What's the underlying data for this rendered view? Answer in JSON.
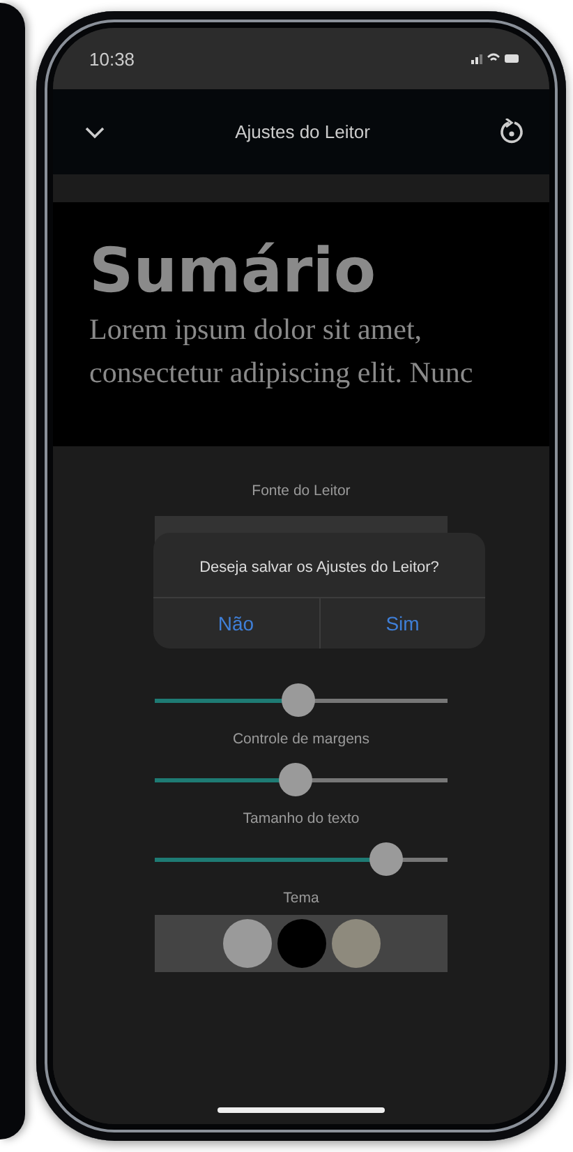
{
  "status_bar": {
    "time": "10:38"
  },
  "nav_bar": {
    "title": "Ajustes do Leitor"
  },
  "preview": {
    "heading": "Sumário",
    "text": "Lorem ipsum dolor sit amet, consectetur adipiscing elit. Nunc"
  },
  "font_section": {
    "label": "Fonte do Leitor"
  },
  "sliders": [
    {
      "level": 0.49
    },
    {
      "label": "Controle de margens",
      "level": 0.48
    },
    {
      "label": "Tamanho do texto",
      "level": 0.79
    }
  ],
  "theme": {
    "label": "Tema",
    "options": [
      {
        "color": "#9a9a9a"
      },
      {
        "color": "#000000"
      },
      {
        "color": "#8e8a7d"
      }
    ]
  },
  "dialog": {
    "message": "Deseja salvar os Ajustes do Leitor?",
    "buttons": [
      "Não",
      "Sim"
    ]
  }
}
